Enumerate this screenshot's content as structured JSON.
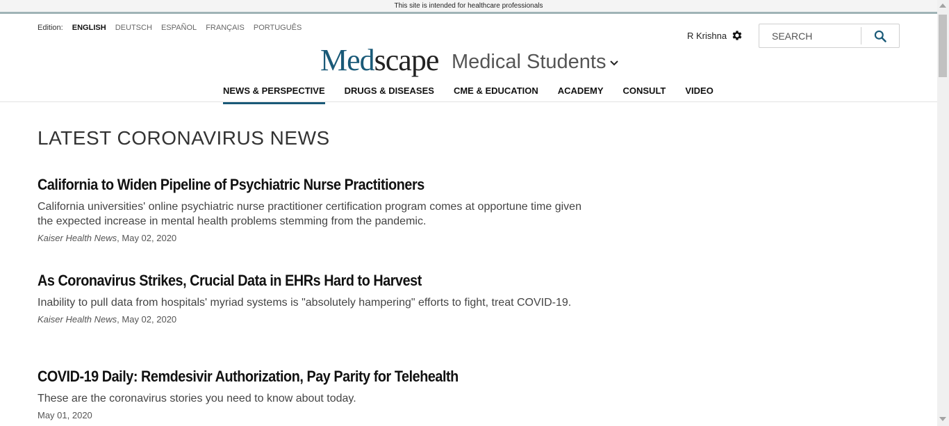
{
  "banner": "This site is intended for healthcare professionals",
  "edition": {
    "label": "Edition:",
    "options": [
      "ENGLISH",
      "DEUTSCH",
      "ESPAÑOL",
      "FRANÇAIS",
      "PORTUGUÊS"
    ],
    "selected": "ENGLISH"
  },
  "user": {
    "name": "R Krishna",
    "settings_icon": "gear-icon"
  },
  "search": {
    "placeholder": "SEARCH",
    "value": "",
    "button_icon": "search-icon"
  },
  "brand": {
    "logo_part1": "Med",
    "logo_part2": "scape",
    "section": "Medical Students",
    "section_icon": "chevron-down-icon"
  },
  "nav": {
    "items": [
      "NEWS & PERSPECTIVE",
      "DRUGS & DISEASES",
      "CME & EDUCATION",
      "ACADEMY",
      "CONSULT",
      "VIDEO"
    ],
    "active": "NEWS & PERSPECTIVE"
  },
  "main": {
    "heading": "LATEST CORONAVIRUS NEWS",
    "articles": [
      {
        "title": "California to Widen Pipeline of Psychiatric Nurse Practitioners",
        "summary": "California universities' online psychiatric nurse practitioner certification program comes at opportune time given the expected increase in mental health problems stemming from the pandemic.",
        "source": "Kaiser Health News",
        "date": "May 02, 2020",
        "date_line": ", May 02, 2020"
      },
      {
        "title": "As Coronavirus Strikes, Crucial Data in EHRs Hard to Harvest",
        "summary": "Inability to pull data from hospitals' myriad systems is \"absolutely hampering\" efforts to fight, treat COVID-19.",
        "source": "Kaiser Health News",
        "date": "May 02, 2020",
        "date_line": ", May 02, 2020"
      },
      {
        "title": "COVID-19 Daily: Remdesivir Authorization, Pay Parity for Telehealth",
        "summary": "These are the coronavirus stories you need to know about today.",
        "source": "",
        "date": "May 01, 2020",
        "date_line": "May 01, 2020"
      }
    ]
  },
  "colors": {
    "accent": "#1a5a78",
    "topline": "#9fb3b6"
  }
}
